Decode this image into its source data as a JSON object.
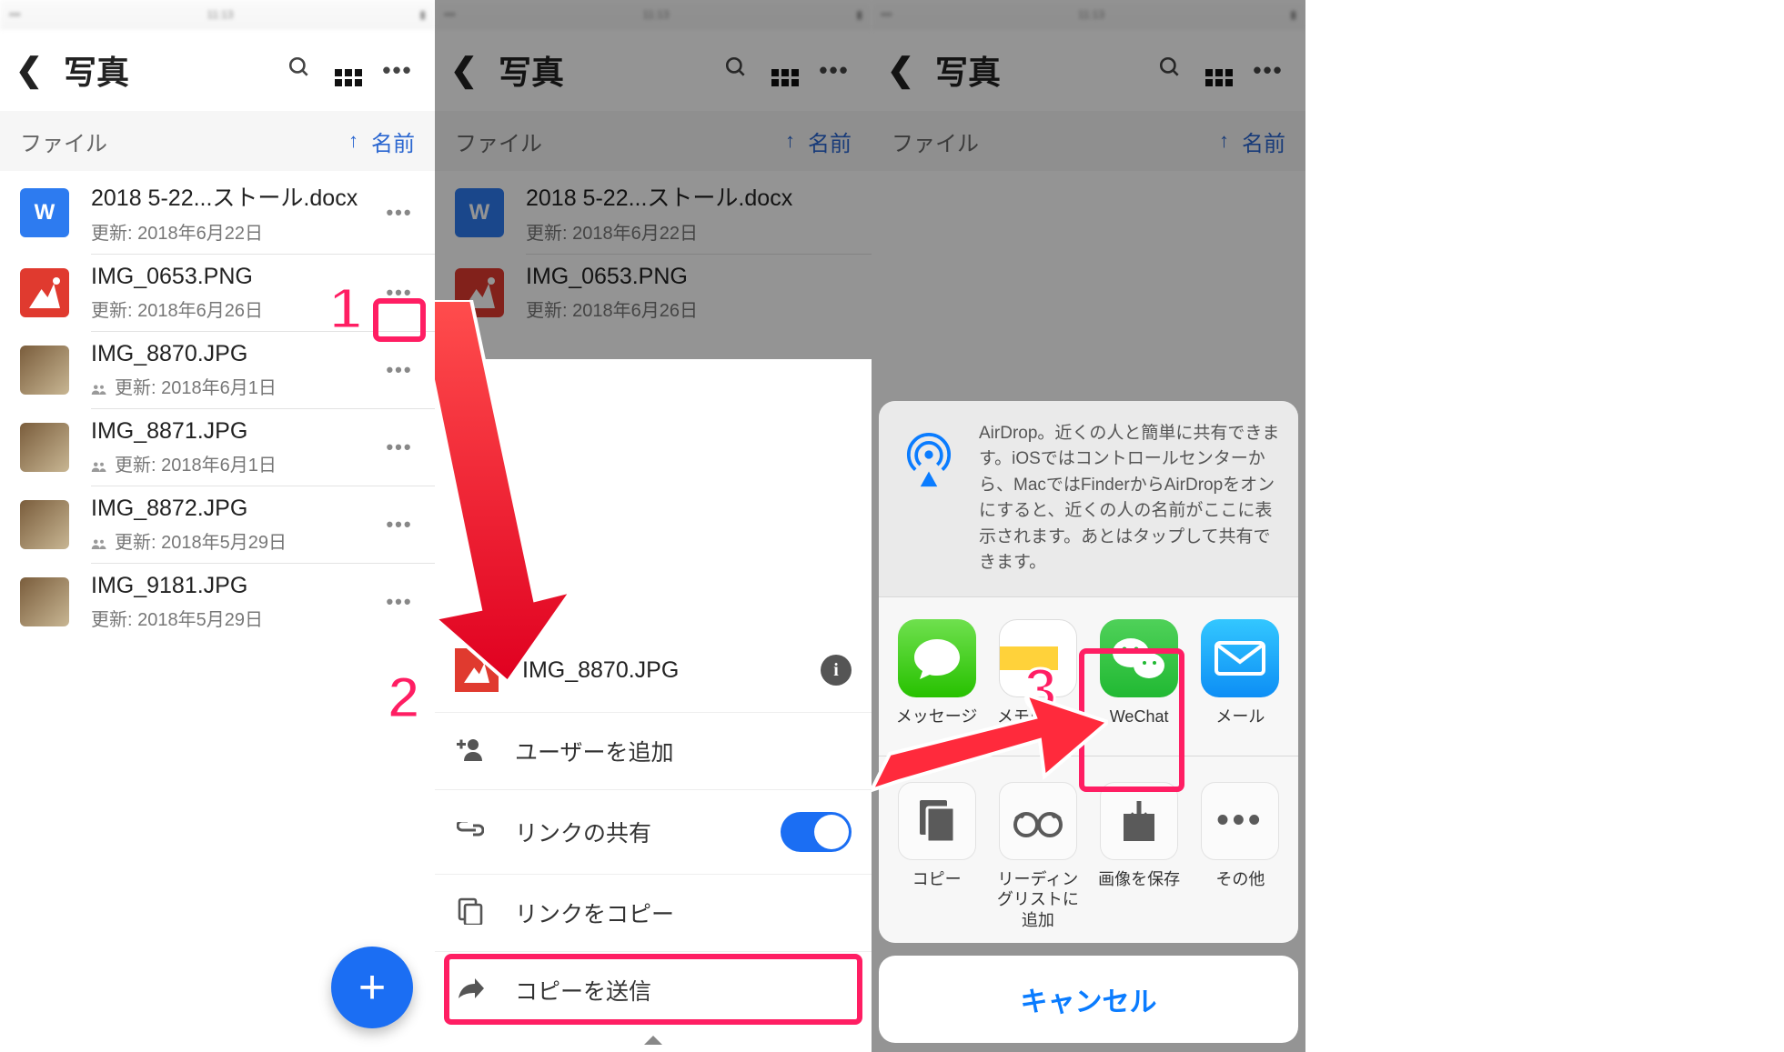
{
  "header": {
    "title": "写真",
    "back_aria": "back",
    "search_aria": "search",
    "view_aria": "grid-view",
    "more_aria": "more"
  },
  "sort": {
    "label": "ファイル",
    "direction_icon": "↑",
    "by": "名前"
  },
  "files": [
    {
      "name": "2018 5-22...ストール.docx",
      "meta": "更新: 2018年6月22日",
      "type": "docx",
      "shared": false
    },
    {
      "name": "IMG_0653.PNG",
      "meta": "更新: 2018年6月26日",
      "type": "png",
      "shared": false
    },
    {
      "name": "IMG_8870.JPG",
      "meta": "更新: 2018年6月1日",
      "type": "jpg",
      "shared": true
    },
    {
      "name": "IMG_8871.JPG",
      "meta": "更新: 2018年6月1日",
      "type": "jpg",
      "shared": true
    },
    {
      "name": "IMG_8872.JPG",
      "meta": "更新: 2018年5月29日",
      "type": "jpg",
      "shared": true
    },
    {
      "name": "IMG_9181.JPG",
      "meta": "更新: 2018年5月29日",
      "type": "jpg",
      "shared": false
    }
  ],
  "sheet2": {
    "file": "IMG_8870.JPG",
    "options": {
      "add_user": "ユーザーを追加",
      "share_link": "リンクの共有",
      "copy_link": "リンクをコピー",
      "send_copy": "コピーを送信"
    },
    "share_link_on": true
  },
  "share_sheet": {
    "airdrop_text": "AirDrop。近くの人と簡単に共有できます。iOSではコントロールセンターから、MacではFinderからAirDropをオンにすると、近くの人の名前がここに表示されます。あとはタップして共有できます。",
    "apps": [
      "メッセージ",
      "メモに追加",
      "WeChat",
      "メール"
    ],
    "actions": [
      "コピー",
      "リーディングリストに追加",
      "画像を保存",
      "その他"
    ],
    "cancel": "キャンセル"
  },
  "annotations": {
    "step1": "1",
    "step2": "2",
    "step3": "3"
  }
}
